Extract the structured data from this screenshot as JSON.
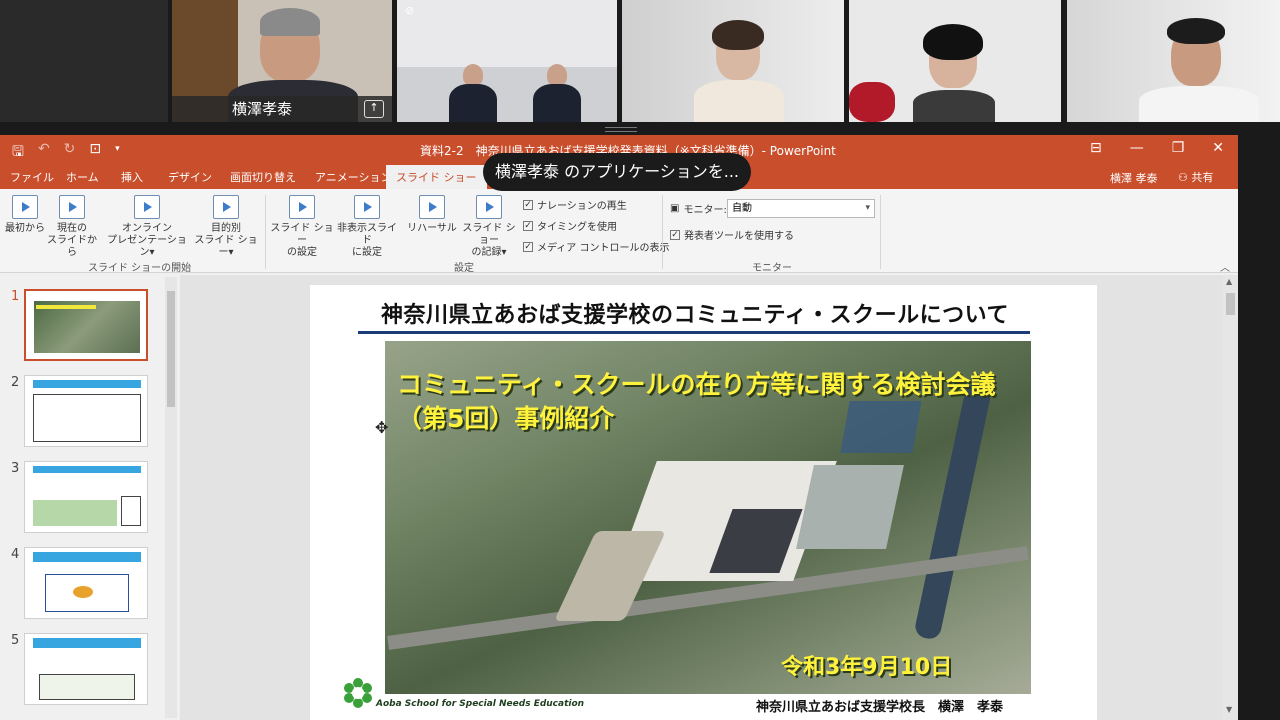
{
  "video": {
    "participants": [
      {
        "name": "横澤孝泰",
        "share_icon": "share-screen-icon"
      }
    ]
  },
  "toast": "横澤孝泰 のアプリケーションを...",
  "ppt": {
    "window_title": "資料2-2　神奈川県立あおば支援学校発表資料（※文科省準備）- PowerPoint",
    "tabs": [
      "ファイル",
      "ホーム",
      "挿入",
      "デザイン",
      "画面切り替え",
      "アニメーション",
      "スライド ショー"
    ],
    "user": "横澤 孝泰",
    "share": "共有",
    "ribbon": {
      "from_start": "最初から",
      "from_current_1": "現在の",
      "from_current_2": "スライドから",
      "online_1": "オンライン",
      "online_2": "プレゼンテーション",
      "custom_1": "目的別",
      "custom_2": "スライド ショー",
      "setup_1": "スライド ショー",
      "setup_2": "の設定",
      "hide_1": "非表示スライド",
      "hide_2": "に設定",
      "rehearse": "リハーサル",
      "record_1": "スライド ショー",
      "record_2": "の記録",
      "chk_narration": "ナレーションの再生",
      "chk_timing": "タイミングを使用",
      "chk_media": "メディア コントロールの表示",
      "monitor_label": "モニター:",
      "monitor_value": "自動",
      "presenter_view": "発表者ツールを使用する",
      "group_start": "スライド ショーの開始",
      "group_setup": "設定",
      "group_monitor": "モニター"
    },
    "slide_numbers": [
      "1",
      "2",
      "3",
      "4",
      "5"
    ],
    "slide": {
      "title": "神奈川県立あおば支援学校のコミュニティ・スクールについて",
      "overlay_1": "コミュニティ・スクールの在り方等に関する検討会議",
      "overlay_2": "（第5回）事例紹介",
      "date": "令和3年9月10日",
      "school_en": "Aoba School for Special Needs Education",
      "author": "神奈川県立あおば支援学校長　横澤　孝泰"
    }
  }
}
